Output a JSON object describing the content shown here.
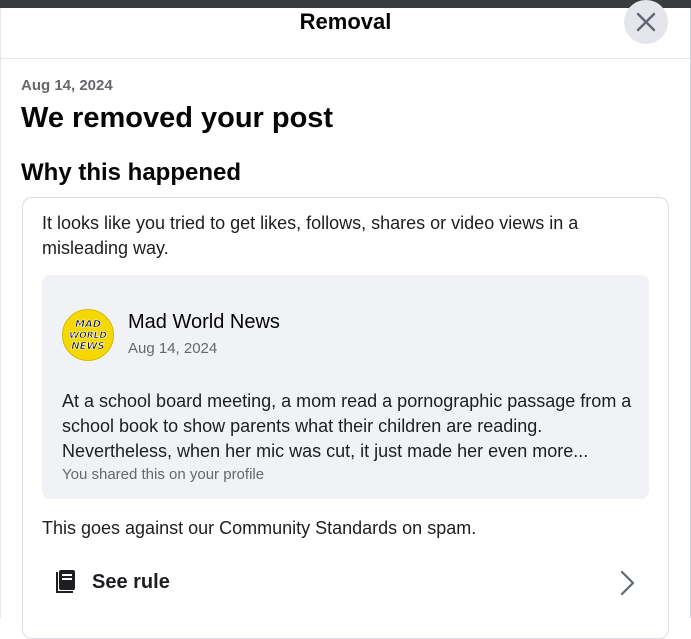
{
  "dialog": {
    "title": "Removal",
    "close_icon": "close-icon"
  },
  "notice": {
    "date": "Aug 14, 2024",
    "headline": "We removed your post",
    "section_title": "Why this happened",
    "explanation": "It looks like you tried to get likes, follows, shares or video views in a misleading way."
  },
  "post": {
    "author": "Mad World News",
    "avatar_text": [
      "MAD",
      "WORLD",
      "NEWS"
    ],
    "date": "Aug 14, 2024",
    "text": "At a school board meeting, a mom read a pornographic passage from a school book to show parents what their children are reading. Nevertheless, when her mic was cut, it just made her even more...",
    "note": "You shared this on your profile"
  },
  "standards": {
    "text": "This goes against our Community Standards on spam.",
    "see_rule_label": "See rule",
    "rule_icon": "rule-book-icon",
    "chevron_icon": "chevron-right-icon"
  },
  "colors": {
    "topbar": "#3a3b3c",
    "secondary_text": "#65676b",
    "post_background": "#f0f2f5",
    "avatar_yellow": "#f5d800"
  }
}
